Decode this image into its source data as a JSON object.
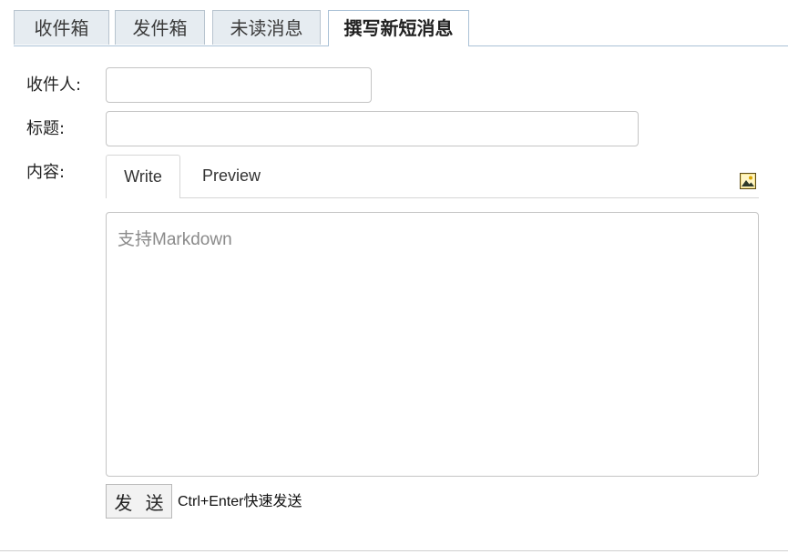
{
  "tabs": [
    {
      "label": "收件箱",
      "active": false
    },
    {
      "label": "发件箱",
      "active": false
    },
    {
      "label": "未读消息",
      "active": false
    },
    {
      "label": "撰写新短消息",
      "active": true
    }
  ],
  "form": {
    "recipient_label": "收件人:",
    "recipient_value": "",
    "subject_label": "标题:",
    "subject_value": "",
    "content_label": "内容:",
    "editor_tabs": {
      "write": "Write",
      "preview": "Preview",
      "active": "Write"
    },
    "image_icon": "insert-image-icon",
    "content_placeholder": "支持Markdown",
    "content_value": ""
  },
  "footer": {
    "send_label": "发 送",
    "hint": "Ctrl+Enter快速发送"
  },
  "colors": {
    "tab_background": "#e6ecf1",
    "tab_border": "#aac1d6",
    "input_border": "#c4c4c4"
  }
}
